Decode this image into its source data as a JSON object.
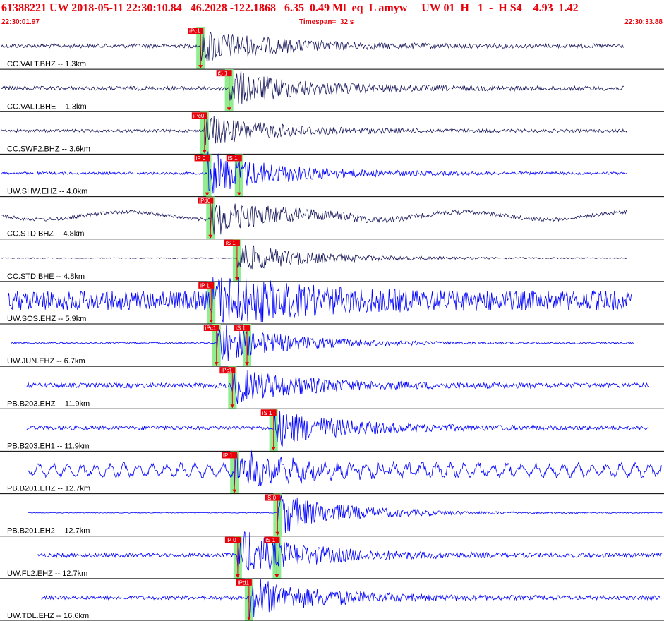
{
  "header": {
    "title": "61388221 UW 2018-05-11 22:30:10.84   46.2028 -122.1868   6.35  0.49 Ml  eq  L amyw     UW 01  H   1  -  H S4    4.93  1.42",
    "start_time": "22:30:01.97",
    "timespan": "Timespan=  32 s",
    "end_time": "22:30:33.88"
  },
  "colors": {
    "title": "#e8000b",
    "pick_box": "#e8000b",
    "pick_highlight": "#90ee90",
    "trace_dark": "#1a1a5e",
    "trace_blue": "#0000ff",
    "divider": "#000000"
  },
  "channels": [
    {
      "label": "CC.VALT.BHZ -- 1.3km",
      "color": "dark",
      "amp": 0.4,
      "noise": 0.12,
      "start": 0.0,
      "end": 0.94,
      "picks": [
        {
          "label": "iPc1",
          "t": 0.302
        }
      ]
    },
    {
      "label": "CC.VALT.BHE -- 1.3km",
      "color": "dark",
      "amp": 0.4,
      "noise": 0.12,
      "start": 0.0,
      "end": 0.94,
      "picks": [
        {
          "label": "iS 1",
          "t": 0.345
        }
      ]
    },
    {
      "label": "CC.SWF2.BHZ -- 3.6km",
      "color": "dark",
      "amp": 0.35,
      "noise": 0.1,
      "start": 0.0,
      "end": 0.945,
      "picks": [
        {
          "label": "iPc0",
          "t": 0.308
        }
      ]
    },
    {
      "label": "UW.SHW.EHZ -- 4.0km",
      "color": "blue",
      "amp": 0.5,
      "noise": 0.06,
      "start": 0.0,
      "end": 0.945,
      "picks": [
        {
          "label": "iP 0",
          "t": 0.312
        },
        {
          "label": "iS 1",
          "t": 0.36
        }
      ]
    },
    {
      "label": "CC.STD.BHZ -- 4.8km",
      "color": "dark",
      "amp": 0.4,
      "noise": 0.1,
      "start": 0.0,
      "end": 0.945,
      "picks": [
        {
          "label": "iPd0",
          "t": 0.317
        }
      ]
    },
    {
      "label": "CC.STD.BHE -- 4.8km",
      "color": "dark",
      "amp": 0.35,
      "noise": 0.03,
      "start": 0.0,
      "end": 0.945,
      "picks": [
        {
          "label": "iS 1",
          "t": 0.357
        }
      ]
    },
    {
      "label": "UW.SOS.EHZ -- 5.9km",
      "color": "blue",
      "amp": 0.55,
      "noise": 0.42,
      "start": 0.01,
      "end": 0.952,
      "picks": [
        {
          "label": "iP 1",
          "t": 0.318
        }
      ]
    },
    {
      "label": "UW.JUN.EHZ -- 6.7km",
      "color": "blue",
      "amp": 0.45,
      "noise": 0.04,
      "start": 0.015,
      "end": 0.955,
      "picks": [
        {
          "label": "iPc1",
          "t": 0.326
        },
        {
          "label": "iS 1",
          "t": 0.372
        }
      ]
    },
    {
      "label": "PB.B203.EHZ -- 11.9km",
      "color": "blue",
      "amp": 0.4,
      "noise": 0.14,
      "start": 0.038,
      "end": 0.978,
      "picks": [
        {
          "label": "iPc1",
          "t": 0.35
        }
      ]
    },
    {
      "label": "PB.B203.EH1 -- 11.9km",
      "color": "blue",
      "amp": 0.4,
      "noise": 0.12,
      "start": 0.038,
      "end": 0.978,
      "picks": [
        {
          "label": "iS 1",
          "t": 0.412
        }
      ]
    },
    {
      "label": "PB.B201.EHZ -- 12.7km",
      "color": "blue",
      "amp": 0.35,
      "noise": 0.2,
      "start": 0.04,
      "end": 0.998,
      "picks": [
        {
          "label": "iP 1",
          "t": 0.353
        }
      ]
    },
    {
      "label": "PB.B201.EH2 -- 12.7km",
      "color": "blue",
      "amp": 0.45,
      "noise": 0.02,
      "start": 0.04,
      "end": 0.998,
      "picks": [
        {
          "label": "iS 0",
          "t": 0.418
        }
      ]
    },
    {
      "label": "UW.FL2.EHZ -- 12.7km",
      "color": "blue",
      "amp": 0.5,
      "noise": 0.1,
      "start": 0.055,
      "end": 0.998,
      "picks": [
        {
          "label": "iP 0",
          "t": 0.358
        },
        {
          "label": "iS 1",
          "t": 0.417
        }
      ]
    },
    {
      "label": "UW.TDL.EHZ -- 16.6km",
      "color": "blue",
      "amp": 0.45,
      "noise": 0.1,
      "start": 0.06,
      "end": 0.998,
      "picks": [
        {
          "label": "iPd1",
          "t": 0.375
        }
      ]
    }
  ]
}
